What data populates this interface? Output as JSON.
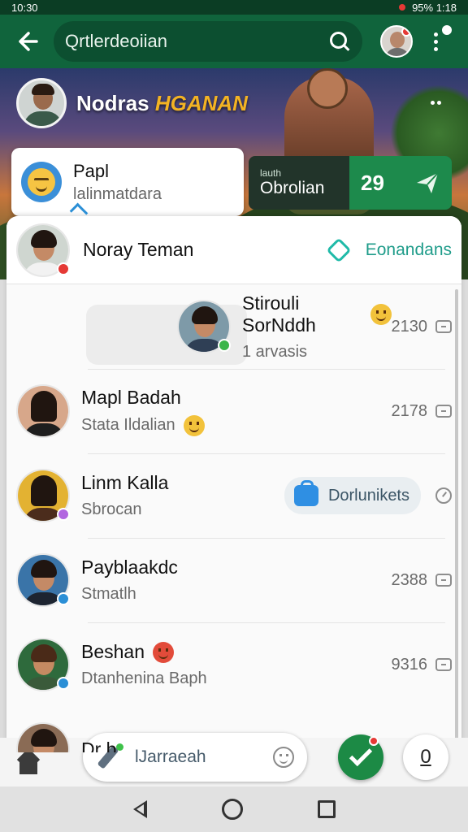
{
  "status_bar": {
    "time": "10:30",
    "battery": "95% 1:18"
  },
  "app_bar": {
    "search_text": "Qrtlerdeoiian"
  },
  "banner": {
    "title_main": "Nodras",
    "title_accent": "HGANAN",
    "mini_card": {
      "name": "Papl",
      "subtitle": "lalinmatdara"
    },
    "stat_card": {
      "label_small": "lauth",
      "label_main": "Obrolian",
      "value": "29"
    }
  },
  "pinned": {
    "name": "Noray Teman",
    "link_label": "Eonandans"
  },
  "chats": [
    {
      "name": "Stirouli SorNddh",
      "preview": "1 arvasis",
      "time": "2130",
      "name_emoji": "yellow",
      "status_color": "#3bb54a",
      "meta_icon": "message-icon",
      "avatar_bg": "#7e9aa8"
    },
    {
      "name": "Mapl Badah",
      "preview": "Stata Ildalian",
      "time": "2178",
      "preview_emoji": "yellow",
      "status_color": null,
      "meta_icon": "message-icon",
      "avatar_bg": "#d7a78a"
    },
    {
      "name": "Linm Kalla",
      "preview": "Sbrocan",
      "pill_label": "Dorlunikets",
      "status_color": "#b266e0",
      "meta_icon": "clock-icon",
      "avatar_bg": "#e3b232"
    },
    {
      "name": "Payblaakdc",
      "preview": "Stmatlh",
      "time": "2388",
      "status_color": "#2b8fd6",
      "meta_icon": "message-icon",
      "avatar_bg": "#3a74a8"
    },
    {
      "name": "Beshan",
      "preview": "Dtanhenina Baph",
      "time": "9316",
      "name_emoji": "red",
      "status_color": "#2b8fd6",
      "meta_icon": "message-icon",
      "avatar_bg": "#2e6a3c"
    }
  ],
  "partial_row": {
    "name": "Dr b"
  },
  "compose": {
    "placeholder": "lJarraeah"
  },
  "right_button": {
    "label": "0"
  },
  "colors": {
    "primary": "#10643c",
    "accent": "#1d8a4c",
    "link": "#1f9c8a"
  }
}
